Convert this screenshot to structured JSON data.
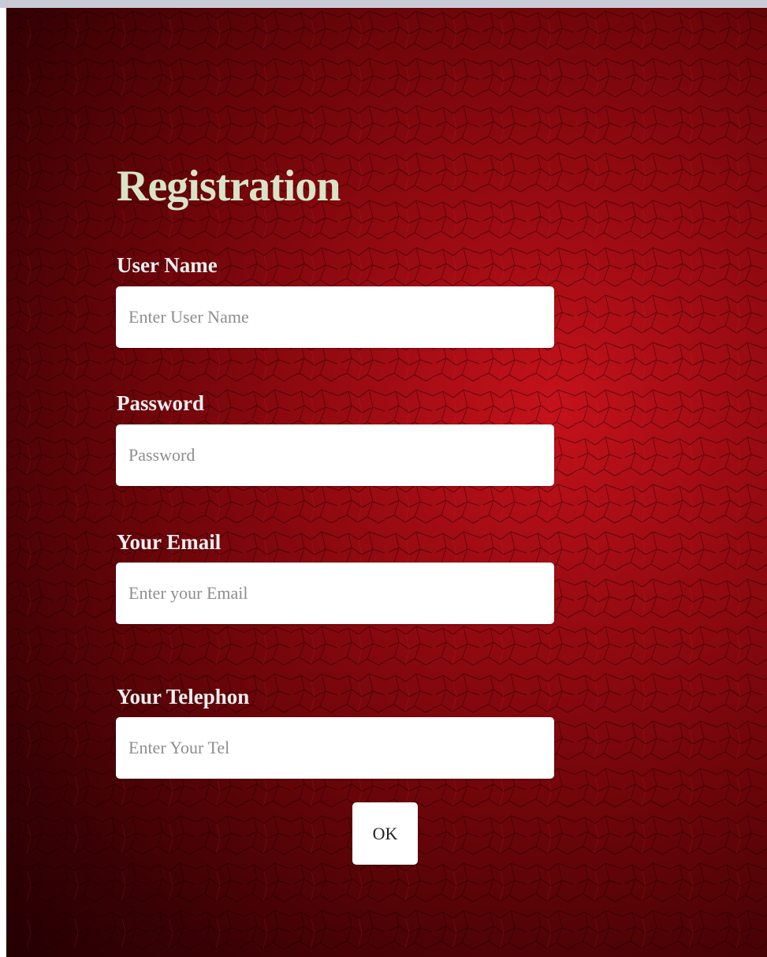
{
  "form": {
    "title": "Registration",
    "fields": [
      {
        "label": "User Name",
        "placeholder": "Enter User Name",
        "value": ""
      },
      {
        "label": "Password",
        "placeholder": "Password",
        "value": ""
      },
      {
        "label": "Your Email",
        "placeholder": "Enter your Email",
        "value": ""
      },
      {
        "label": "Your Telephon",
        "placeholder": "Enter Your Tel",
        "value": ""
      }
    ],
    "submit_label": "OK"
  },
  "colors": {
    "background_accent": "#c5121c",
    "title_color": "#d8e4c8",
    "label_color": "#eceff0"
  }
}
